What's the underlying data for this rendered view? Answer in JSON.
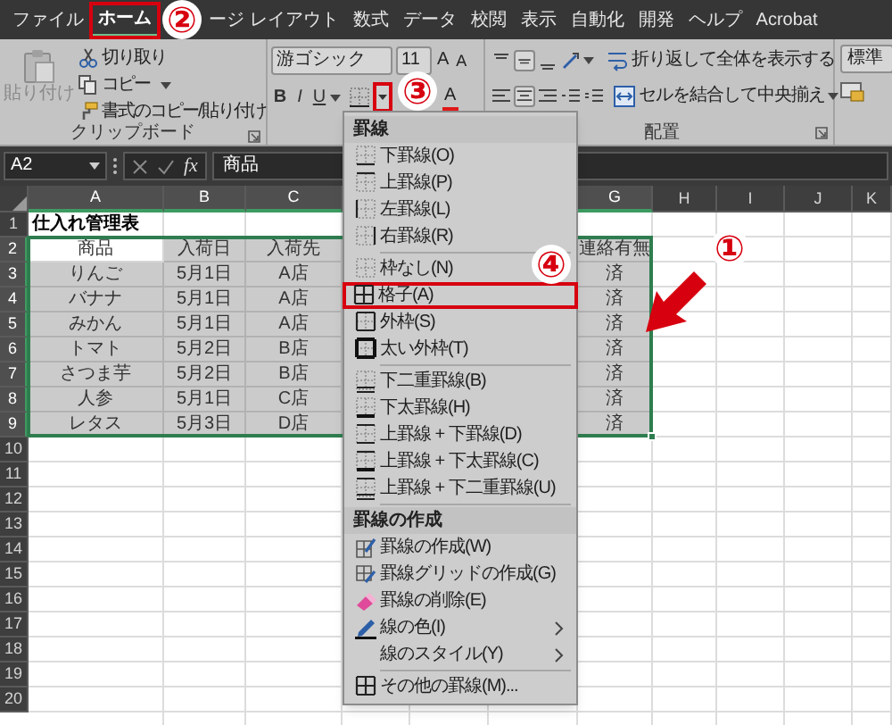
{
  "menu_tabs": [
    {
      "label": "ファイル",
      "selected": false,
      "highlighted": false
    },
    {
      "label": "ホーム",
      "selected": true,
      "highlighted": true
    },
    {
      "label": "ージ レイアウト",
      "selected": false,
      "highlighted": false
    },
    {
      "label": "数式",
      "selected": false,
      "highlighted": false
    },
    {
      "label": "データ",
      "selected": false,
      "highlighted": false
    },
    {
      "label": "校閲",
      "selected": false,
      "highlighted": false
    },
    {
      "label": "表示",
      "selected": false,
      "highlighted": false
    },
    {
      "label": "自動化",
      "selected": false,
      "highlighted": false
    },
    {
      "label": "開発",
      "selected": false,
      "highlighted": false
    },
    {
      "label": "ヘルプ",
      "selected": false,
      "highlighted": false
    },
    {
      "label": "Acrobat",
      "selected": false,
      "highlighted": false
    }
  ],
  "ribbon": {
    "clipboard": {
      "paste": {
        "label": "貼り付け",
        "disabled": true
      },
      "cut": "切り取り",
      "copy": "コピー",
      "format_painter": "書式のコピー/貼り付け",
      "group_label": "クリップボード"
    },
    "font": {
      "font_name": "游ゴシック",
      "font_size": "11",
      "grow": "A",
      "shrink": "A",
      "bold": "B",
      "italic": "I",
      "underline": "U",
      "borders_highlighted": true,
      "font_color": "A"
    },
    "alignment": {
      "wrap_text": "折り返して全体を表示する",
      "merge_center": "セルを結合して中央揃え",
      "group_label": "配置"
    },
    "number": {
      "format": "標準"
    }
  },
  "formula_bar": {
    "name_box": "A2",
    "function_label": "fx",
    "value": "商品"
  },
  "sheet": {
    "columns": [
      {
        "label": "A",
        "selected": true
      },
      {
        "label": "B",
        "selected": true
      },
      {
        "label": "C",
        "selected": true
      },
      null,
      null,
      null,
      {
        "label": "G",
        "selected": true
      },
      {
        "label": "H",
        "selected": false
      },
      {
        "label": "I",
        "selected": false
      },
      {
        "label": "J",
        "selected": false
      },
      {
        "label": "K",
        "selected": false
      }
    ],
    "rows": [
      {
        "header": "1",
        "selected": false,
        "bold": true,
        "cells": [
          "仕入れ管理表"
        ]
      },
      {
        "header": "2",
        "selected": true,
        "bold": false,
        "cells": [
          "商品",
          "入荷日",
          "入荷先",
          null,
          null,
          null,
          "連絡有無"
        ]
      },
      {
        "header": "3",
        "selected": true,
        "bold": false,
        "cells": [
          "りんご",
          "5月1日",
          "A店",
          null,
          null,
          null,
          "済"
        ]
      },
      {
        "header": "4",
        "selected": true,
        "bold": false,
        "cells": [
          "バナナ",
          "5月1日",
          "A店",
          null,
          null,
          null,
          "済"
        ]
      },
      {
        "header": "5",
        "selected": true,
        "bold": false,
        "cells": [
          "みかん",
          "5月1日",
          "A店",
          null,
          null,
          null,
          "済"
        ]
      },
      {
        "header": "6",
        "selected": true,
        "bold": false,
        "cells": [
          "トマト",
          "5月2日",
          "B店",
          null,
          null,
          null,
          "済"
        ]
      },
      {
        "header": "7",
        "selected": true,
        "bold": false,
        "cells": [
          "さつま芋",
          "5月2日",
          "B店",
          null,
          null,
          null,
          "済"
        ]
      },
      {
        "header": "8",
        "selected": true,
        "bold": false,
        "cells": [
          "人参",
          "5月1日",
          "C店",
          null,
          null,
          null,
          "済"
        ]
      },
      {
        "header": "9",
        "selected": true,
        "bold": false,
        "cells": [
          "レタス",
          "5月3日",
          "D店",
          null,
          null,
          null,
          "済"
        ]
      },
      {
        "header": "10",
        "selected": false
      },
      {
        "header": "11",
        "selected": false
      },
      {
        "header": "12",
        "selected": false
      },
      {
        "header": "13",
        "selected": false
      },
      {
        "header": "14",
        "selected": false
      },
      {
        "header": "15",
        "selected": false
      },
      {
        "header": "16",
        "selected": false
      },
      {
        "header": "17",
        "selected": false
      },
      {
        "header": "18",
        "selected": false
      },
      {
        "header": "19",
        "selected": false
      },
      {
        "header": "20",
        "selected": false
      }
    ]
  },
  "border_menu": {
    "items": [
      {
        "kind": "header",
        "label": "罫線"
      },
      {
        "kind": "item",
        "label": "下罫線(O)",
        "highlighted": false,
        "submenu": false
      },
      {
        "kind": "item",
        "label": "上罫線(P)",
        "highlighted": false,
        "submenu": false
      },
      {
        "kind": "item",
        "label": "左罫線(L)",
        "highlighted": false,
        "submenu": false
      },
      {
        "kind": "item",
        "label": "右罫線(R)",
        "highlighted": false,
        "submenu": false
      },
      {
        "kind": "separator"
      },
      {
        "kind": "item",
        "label": "枠なし(N)",
        "highlighted": false,
        "submenu": false
      },
      {
        "kind": "item",
        "label": "格子(A)",
        "highlighted": true,
        "submenu": false
      },
      {
        "kind": "item",
        "label": "外枠(S)",
        "highlighted": false,
        "submenu": false
      },
      {
        "kind": "item",
        "label": "太い外枠(T)",
        "highlighted": false,
        "submenu": false
      },
      {
        "kind": "separator"
      },
      {
        "kind": "item",
        "label": "下二重罫線(B)",
        "highlighted": false,
        "submenu": false
      },
      {
        "kind": "item",
        "label": "下太罫線(H)",
        "highlighted": false,
        "submenu": false
      },
      {
        "kind": "item",
        "label": "上罫線 + 下罫線(D)",
        "highlighted": false,
        "submenu": false
      },
      {
        "kind": "item",
        "label": "上罫線 + 下太罫線(C)",
        "highlighted": false,
        "submenu": false
      },
      {
        "kind": "item",
        "label": "上罫線 + 下二重罫線(U)",
        "highlighted": false,
        "submenu": false
      },
      {
        "kind": "separator"
      },
      {
        "kind": "header",
        "label": "罫線の作成"
      },
      {
        "kind": "item",
        "label": "罫線の作成(W)",
        "highlighted": false,
        "submenu": false
      },
      {
        "kind": "item",
        "label": "罫線グリッドの作成(G)",
        "highlighted": false,
        "submenu": false
      },
      {
        "kind": "item",
        "label": "罫線の削除(E)",
        "highlighted": false,
        "submenu": false
      },
      {
        "kind": "item",
        "label": "線の色(I)",
        "highlighted": false,
        "submenu": true
      },
      {
        "kind": "item",
        "label": "線のスタイル(Y)",
        "highlighted": false,
        "submenu": true
      },
      {
        "kind": "separator"
      },
      {
        "kind": "item",
        "label": "その他の罫線(M)...",
        "highlighted": false,
        "submenu": false
      }
    ]
  },
  "callouts": [
    {
      "label": "①"
    },
    {
      "label": "②"
    },
    {
      "label": "③"
    },
    {
      "label": "④"
    }
  ]
}
